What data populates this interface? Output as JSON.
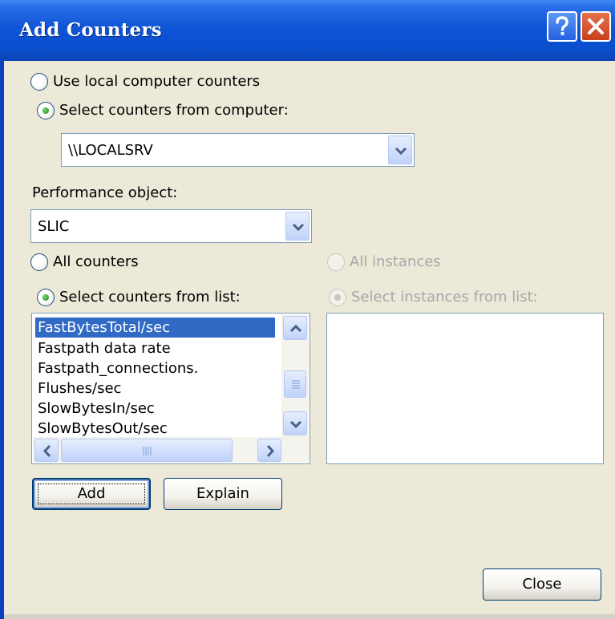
{
  "window": {
    "title": "Add Counters"
  },
  "computer": {
    "use_local_label": "Use local computer counters",
    "select_from_label": "Select counters from computer:",
    "value": "\\\\LOCALSRV"
  },
  "performance_object": {
    "label": "Performance object:",
    "value": "SLIC"
  },
  "counters": {
    "all_label": "All counters",
    "select_label": "Select counters from list:",
    "items": [
      "FastBytesTotal/sec",
      "Fastpath data rate",
      "Fastpath_connections.",
      "Flushes/sec",
      "SlowBytesIn/sec",
      "SlowBytesOut/sec"
    ],
    "selected_index": 0
  },
  "instances": {
    "all_label": "All instances",
    "select_label": "Select instances from list:"
  },
  "buttons": {
    "add": "Add",
    "explain": "Explain",
    "close": "Close"
  },
  "icons": {
    "help": "question-icon",
    "close": "x-icon",
    "dropdown": "chevron-down-icon"
  }
}
